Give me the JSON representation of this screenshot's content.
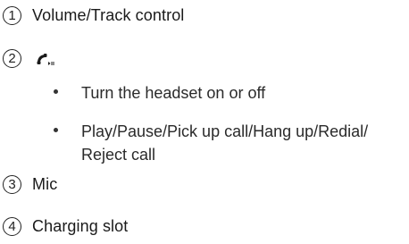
{
  "items": [
    {
      "number": "1",
      "label": "Volume/Track control"
    },
    {
      "number": "2",
      "icon": "phone-play-pause-icon"
    },
    {
      "number": "3",
      "label": "Mic"
    },
    {
      "number": "4",
      "label": "Charging slot"
    }
  ],
  "bullets": [
    "Turn the headset on or off",
    "Play/Pause/Pick up call/Hang up/Redial/",
    "Reject call"
  ]
}
